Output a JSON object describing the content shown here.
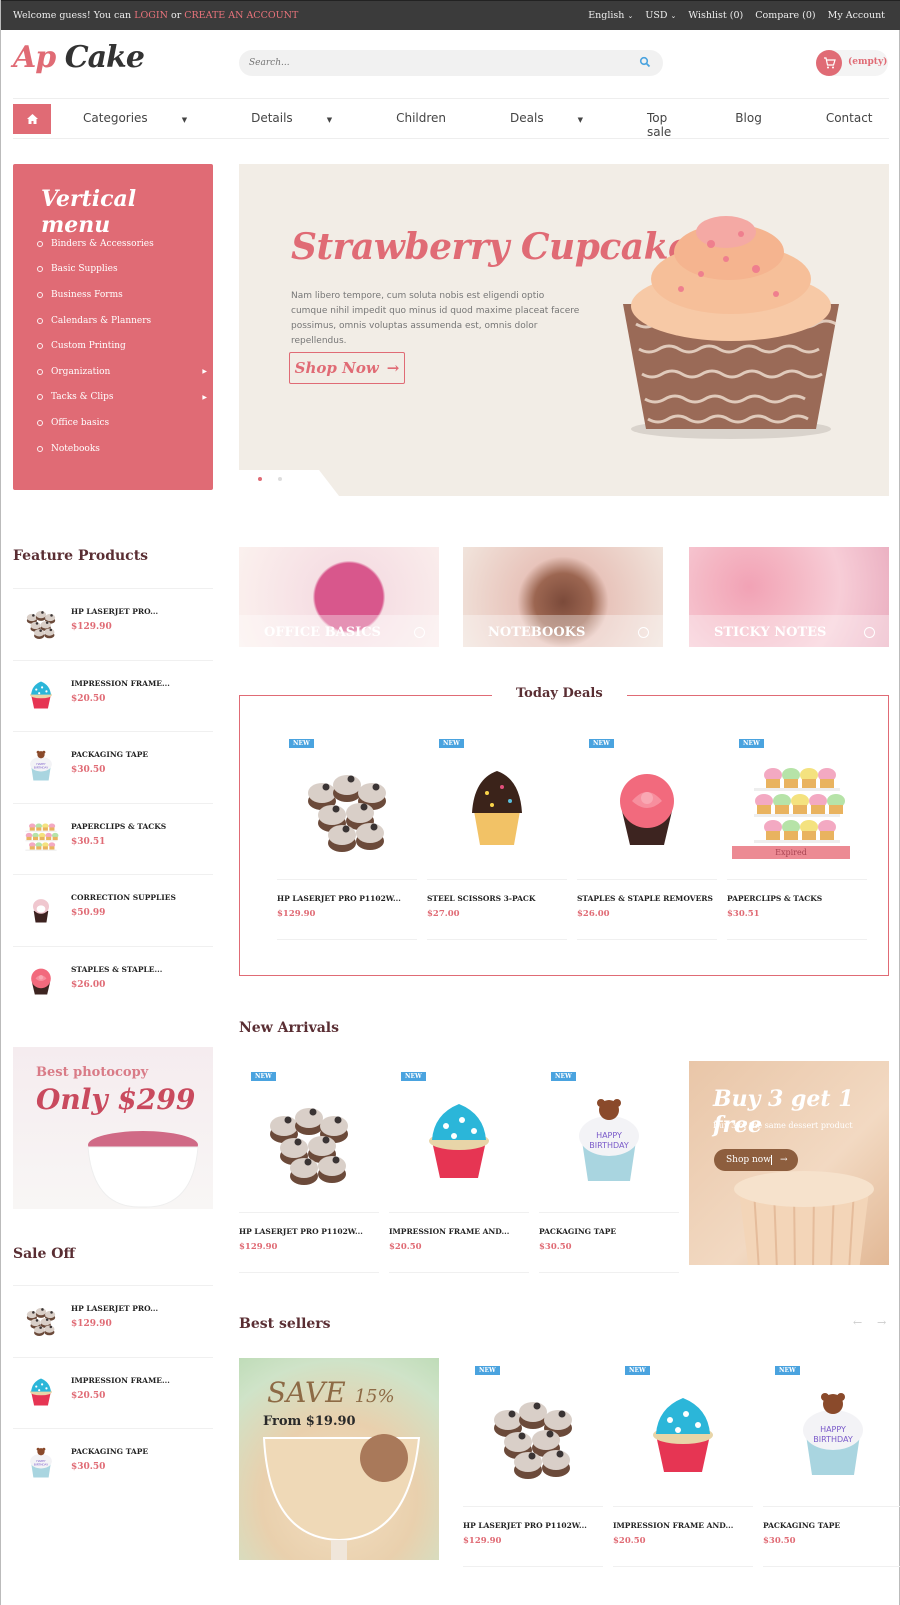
{
  "topbar": {
    "welcome": "Welcome guess! You can ",
    "login": "LOGIN",
    "or": " or ",
    "create": "CREATE AN ACCOUNT",
    "language": "English",
    "currency": "USD",
    "wishlist": "Wishlist (0)",
    "compare": "Compare (0)",
    "account": "My Account"
  },
  "header": {
    "logo_a": "Ap",
    "logo_b": "Cake",
    "search_placeholder": "Search...",
    "cart_label": "(empty)"
  },
  "nav": {
    "items": [
      "Categories",
      "Details",
      "Children",
      "Deals",
      "Top sale",
      "Blog",
      "Contact"
    ],
    "dropdown_flags": [
      true,
      true,
      false,
      true,
      false,
      false,
      false
    ]
  },
  "vertical_menu": {
    "title": "Vertical menu",
    "items": [
      {
        "label": "Binders & Accessories",
        "has_sub": false
      },
      {
        "label": "Basic Supplies",
        "has_sub": false
      },
      {
        "label": "Business Forms",
        "has_sub": false
      },
      {
        "label": "Calendars & Planners",
        "has_sub": false
      },
      {
        "label": "Custom Printing",
        "has_sub": false
      },
      {
        "label": "Organization",
        "has_sub": true
      },
      {
        "label": "Tacks & Clips",
        "has_sub": true
      },
      {
        "label": "Office basics",
        "has_sub": false
      },
      {
        "label": "Notebooks",
        "has_sub": false
      }
    ]
  },
  "slider": {
    "title": "Strawberry Cupcakes",
    "text": "Nam libero tempore, cum soluta nobis est eligendi optio cumque nihil impedit quo minus id quod maxime placeat facere possimus, omnis voluptas assumenda est, omnis dolor repellendus.",
    "button": "Shop Now",
    "slides": 2,
    "active_slide": 1
  },
  "categories": [
    "OFFICE BASICS",
    "NOTEBOOKS",
    "STICKY NOTES"
  ],
  "feature_products": {
    "title": "Feature Products",
    "items": [
      {
        "name": "HP LASERJET PRO...",
        "price": "$129.90",
        "img": "oreo-cupcakes"
      },
      {
        "name": "IMPRESSION FRAME...",
        "price": "$20.50",
        "img": "blue-cupcake"
      },
      {
        "name": "PACKAGING TAPE",
        "price": "$30.50",
        "img": "birthday-cupcake"
      },
      {
        "name": "PAPERCLIPS & TACKS",
        "price": "$30.51",
        "img": "cupcake-tower"
      },
      {
        "name": "CORRECTION SUPPLIES",
        "price": "$50.99",
        "img": "pink-cupcake"
      },
      {
        "name": "STAPLES & STAPLE...",
        "price": "$26.00",
        "img": "rose-cupcake"
      }
    ]
  },
  "today_deals": {
    "title": "Today Deals",
    "badge": "NEW",
    "expired_label": "Expired",
    "items": [
      {
        "name": "HP LASERJET PRO P1102W...",
        "price": "$129.90",
        "img": "oreo-cupcakes",
        "expired": false
      },
      {
        "name": "STEEL SCISSORS 3-PACK",
        "price": "$27.00",
        "img": "chocolate-cupcake",
        "expired": false
      },
      {
        "name": "STAPLES & STAPLE REMOVERS",
        "price": "$26.00",
        "img": "rose-cupcake",
        "expired": false
      },
      {
        "name": "PAPERCLIPS & TACKS",
        "price": "$30.51",
        "img": "cupcake-tower",
        "expired": true
      }
    ]
  },
  "promo_photocopy": {
    "line1": "Best photocopy",
    "line2": "Only $299"
  },
  "new_arrivals": {
    "title": "New Arrivals",
    "badge": "NEW",
    "items": [
      {
        "name": "HP LASERJET PRO P1102W...",
        "price": "$129.90",
        "img": "oreo-cupcakes"
      },
      {
        "name": "IMPRESSION FRAME AND...",
        "price": "$20.50",
        "img": "blue-cupcake"
      },
      {
        "name": "PACKAGING TAPE",
        "price": "$30.50",
        "img": "birthday-cupcake"
      }
    ]
  },
  "promo_buy3": {
    "title": "Buy 3 get 1 free",
    "subtitle": "Buy 3 of the same dessert product",
    "button": "Shop now"
  },
  "sale_off": {
    "title": "Sale Off",
    "items": [
      {
        "name": "HP LASERJET PRO...",
        "price": "$129.90",
        "img": "oreo-cupcakes"
      },
      {
        "name": "IMPRESSION FRAME...",
        "price": "$20.50",
        "img": "blue-cupcake"
      },
      {
        "name": "PACKAGING TAPE",
        "price": "$30.50",
        "img": "birthday-cupcake"
      }
    ]
  },
  "best_sellers": {
    "title": "Best sellers",
    "badge": "NEW",
    "promo_line1": "SAVE",
    "promo_pct": "15%",
    "promo_line2": "From $19.90",
    "items": [
      {
        "name": "HP LASERJET PRO P1102W...",
        "price": "$129.90",
        "img": "oreo-cupcakes"
      },
      {
        "name": "IMPRESSION FRAME AND...",
        "price": "$20.50",
        "img": "blue-cupcake"
      },
      {
        "name": "PACKAGING TAPE",
        "price": "$30.50",
        "img": "birthday-cupcake"
      }
    ]
  },
  "colors": {
    "accent": "#e06b75",
    "topbar": "#3b3b3b",
    "title": "#5a2e33",
    "badge": "#4aa3df"
  }
}
